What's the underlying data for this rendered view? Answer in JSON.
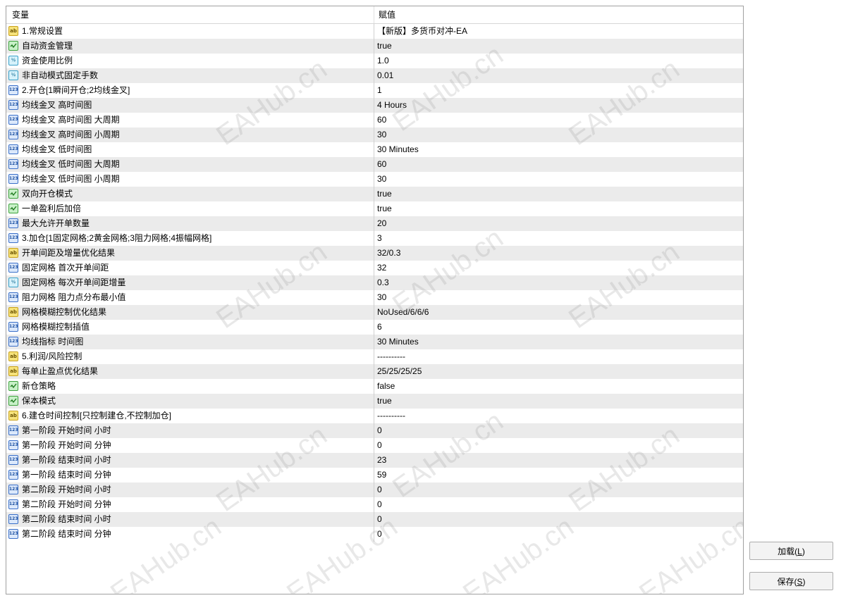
{
  "header": {
    "name": "变量",
    "value": "赋值"
  },
  "rows": [
    {
      "type": "str",
      "name": "1.常规设置",
      "value": "【新版】多货币对冲-EA"
    },
    {
      "type": "bool",
      "name": "自动资金管理",
      "value": "true"
    },
    {
      "type": "dbl",
      "name": "资金使用比例",
      "value": "1.0"
    },
    {
      "type": "dbl",
      "name": "非自动模式固定手数",
      "value": "0.01"
    },
    {
      "type": "int",
      "name": "2.开仓[1瞬间开仓;2均线金叉]",
      "value": "1"
    },
    {
      "type": "int",
      "name": "均线金叉 高时间图",
      "value": "4 Hours"
    },
    {
      "type": "int",
      "name": "均线金叉 高时间图 大周期",
      "value": "60"
    },
    {
      "type": "int",
      "name": "均线金叉 高时间图 小周期",
      "value": "30"
    },
    {
      "type": "int",
      "name": "均线金叉 低时间图",
      "value": "30 Minutes"
    },
    {
      "type": "int",
      "name": "均线金叉 低时间图 大周期",
      "value": "60"
    },
    {
      "type": "int",
      "name": "均线金叉 低时间图 小周期",
      "value": "30"
    },
    {
      "type": "bool",
      "name": "双向开仓模式",
      "value": "true"
    },
    {
      "type": "bool",
      "name": "一单盈利后加倍",
      "value": "true"
    },
    {
      "type": "int",
      "name": "最大允许开单数量",
      "value": "20"
    },
    {
      "type": "int",
      "name": "3.加仓[1固定网格;2黄金网格;3阻力网格;4振幅网格]",
      "value": "3"
    },
    {
      "type": "str",
      "name": "开单间距及增量优化结果",
      "value": "32/0.3"
    },
    {
      "type": "int",
      "name": "固定网格 首次开单间距",
      "value": "32"
    },
    {
      "type": "dbl",
      "name": "固定网格 每次开单间距增量",
      "value": "0.3"
    },
    {
      "type": "int",
      "name": "阻力网格 阻力点分布最小值",
      "value": "30"
    },
    {
      "type": "str",
      "name": "网格模糊控制优化结果",
      "value": "NoUsed/6/6/6"
    },
    {
      "type": "int",
      "name": "网格模糊控制插值",
      "value": "6"
    },
    {
      "type": "int",
      "name": "均线指标 时间图",
      "value": "30 Minutes"
    },
    {
      "type": "str",
      "name": "5.利润/风险控制",
      "value": "----------"
    },
    {
      "type": "str",
      "name": "每单止盈点优化结果",
      "value": "25/25/25/25"
    },
    {
      "type": "bool",
      "name": "新仓策略",
      "value": "false"
    },
    {
      "type": "bool",
      "name": "保本模式",
      "value": "true"
    },
    {
      "type": "str",
      "name": "6.建仓时间控制[只控制建仓,不控制加仓]",
      "value": "----------"
    },
    {
      "type": "int",
      "name": "第一阶段 开始时间 小时",
      "value": "0"
    },
    {
      "type": "int",
      "name": "第一阶段 开始时间 分钟",
      "value": "0"
    },
    {
      "type": "int",
      "name": "第一阶段 结束时间 小时",
      "value": "23"
    },
    {
      "type": "int",
      "name": "第一阶段 结束时间 分钟",
      "value": "59"
    },
    {
      "type": "int",
      "name": "第二阶段 开始时间 小时",
      "value": "0"
    },
    {
      "type": "int",
      "name": "第二阶段 开始时间 分钟",
      "value": "0"
    },
    {
      "type": "int",
      "name": "第二阶段 结束时间 小时",
      "value": "0"
    },
    {
      "type": "int",
      "name": "第二阶段 结束时间 分钟",
      "value": "0"
    }
  ],
  "icons": {
    "str": {
      "name": "string-icon",
      "glyph": "ab"
    },
    "bool": {
      "name": "bool-icon",
      "glyph": ""
    },
    "dbl": {
      "name": "double-icon",
      "glyph": "½"
    },
    "int": {
      "name": "integer-icon",
      "glyph": "123"
    }
  },
  "buttons": {
    "load": {
      "label": "加载(",
      "key": "L",
      "suffix": ")"
    },
    "save": {
      "label": "保存(",
      "key": "S",
      "suffix": ")"
    }
  },
  "watermark": "EAHub.cn"
}
